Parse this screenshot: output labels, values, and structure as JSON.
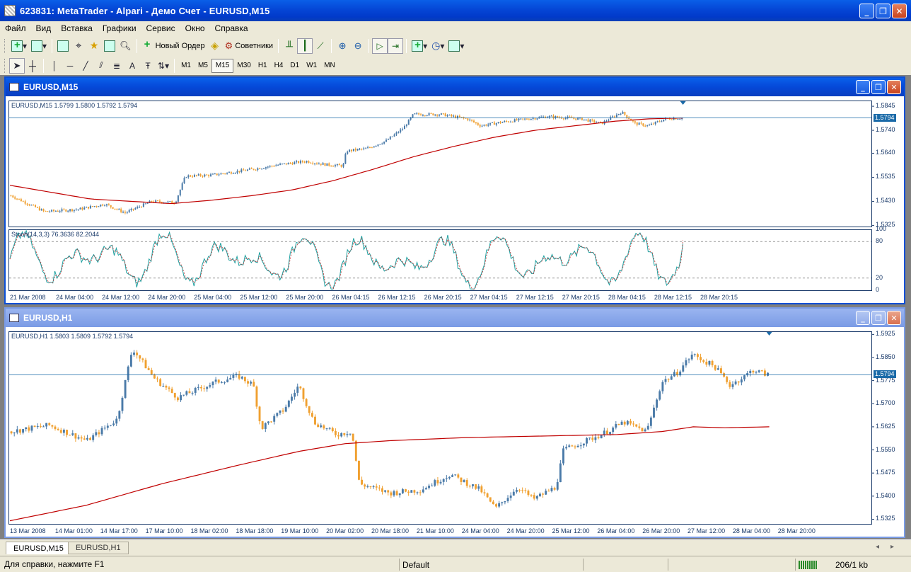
{
  "window": {
    "title": "623831: MetaTrader - Alpari - Демо Счет - EURUSD,M15"
  },
  "menu": [
    "Файл",
    "Вид",
    "Вставка",
    "Графики",
    "Сервис",
    "Окно",
    "Справка"
  ],
  "toolbar": {
    "new_order": "Новый Ордер",
    "experts": "Советники"
  },
  "timeframes": [
    "M1",
    "M5",
    "M15",
    "M30",
    "H1",
    "H4",
    "D1",
    "W1",
    "MN"
  ],
  "active_timeframe": "M15",
  "draw_tools": {
    "text_tool": "A"
  },
  "charts": [
    {
      "window_title": "EURUSD,M15",
      "info": "EURUSD,M15  1.5799 1.5800 1.5792 1.5794",
      "current_price": "1.5794",
      "yticks": [
        "1.5845",
        "1.5740",
        "1.5640",
        "1.5535",
        "1.5430",
        "1.5325"
      ],
      "ylim": [
        1.532,
        1.587
      ],
      "indicator_label": "Stoch(14,3,3) 76.3636 82.2044",
      "ind_ticks": [
        "100",
        "80",
        "20",
        "0"
      ],
      "xticks": [
        "21 Mar 2008",
        "24 Mar 04:00",
        "24 Mar 12:00",
        "24 Mar 20:00",
        "25 Mar 04:00",
        "25 Mar 12:00",
        "25 Mar 20:00",
        "26 Mar 04:15",
        "26 Mar 12:15",
        "26 Mar 20:15",
        "27 Mar 04:15",
        "27 Mar 12:15",
        "27 Mar 20:15",
        "28 Mar 04:15",
        "28 Mar 12:15",
        "28 Mar 20:15"
      ]
    },
    {
      "window_title": "EURUSD,H1",
      "info": "EURUSD,H1  1.5803 1.5809 1.5792 1.5794",
      "current_price": "1.5794",
      "yticks": [
        "1.5925",
        "1.5850",
        "1.5775",
        "1.5700",
        "1.5625",
        "1.5550",
        "1.5475",
        "1.5400",
        "1.5325"
      ],
      "ylim": [
        1.531,
        1.5935
      ],
      "xticks": [
        "13 Mar 2008",
        "14 Mar 01:00",
        "14 Mar 17:00",
        "17 Mar 10:00",
        "18 Mar 02:00",
        "18 Mar 18:00",
        "19 Mar 10:00",
        "20 Mar 02:00",
        "20 Mar 18:00",
        "21 Mar 10:00",
        "24 Mar 04:00",
        "24 Mar 20:00",
        "25 Mar 12:00",
        "26 Mar 04:00",
        "26 Mar 20:00",
        "27 Mar 12:00",
        "28 Mar 04:00",
        "28 Mar 20:00"
      ]
    }
  ],
  "tabs": [
    "EURUSD,M15",
    "EURUSD,H1"
  ],
  "status": {
    "help": "Для справки, нажмите F1",
    "profile": "Default",
    "traffic": "206/1 kb"
  },
  "colors": {
    "bull": "#4a7aa8",
    "bear": "#f0a030",
    "ma": "#c00000",
    "stoch_main": "#1fa0a0",
    "stoch_signal": "#c03030"
  },
  "chart_data": [
    {
      "type": "candlestick",
      "symbol": "EURUSD",
      "timeframe": "M15",
      "close_path": [
        [
          0,
          1.5455
        ],
        [
          0.05,
          1.5385
        ],
        [
          0.1,
          1.5395
        ],
        [
          0.14,
          1.5418
        ],
        [
          0.17,
          1.538
        ],
        [
          0.21,
          1.543
        ],
        [
          0.245,
          1.5425
        ],
        [
          0.26,
          1.554
        ],
        [
          0.3,
          1.5545
        ],
        [
          0.36,
          1.557
        ],
        [
          0.4,
          1.559
        ],
        [
          0.44,
          1.5605
        ],
        [
          0.47,
          1.559
        ],
        [
          0.495,
          1.5585
        ],
        [
          0.5,
          1.565
        ],
        [
          0.53,
          1.566
        ],
        [
          0.56,
          1.5695
        ],
        [
          0.585,
          1.575
        ],
        [
          0.6,
          1.581
        ],
        [
          0.64,
          1.581
        ],
        [
          0.68,
          1.579
        ],
        [
          0.7,
          1.576
        ],
        [
          0.73,
          1.5775
        ],
        [
          0.77,
          1.579
        ],
        [
          0.8,
          1.58
        ],
        [
          0.85,
          1.579
        ],
        [
          0.88,
          1.577
        ],
        [
          0.91,
          1.582
        ],
        [
          0.93,
          1.577
        ],
        [
          0.95,
          1.576
        ],
        [
          0.975,
          1.579
        ],
        [
          1,
          1.5794
        ]
      ],
      "ma_path": [
        [
          0,
          1.55
        ],
        [
          0.06,
          1.547
        ],
        [
          0.12,
          1.544
        ],
        [
          0.18,
          1.543
        ],
        [
          0.24,
          1.542
        ],
        [
          0.3,
          1.5435
        ],
        [
          0.36,
          1.5455
        ],
        [
          0.42,
          1.548
        ],
        [
          0.48,
          1.552
        ],
        [
          0.54,
          1.557
        ],
        [
          0.6,
          1.5625
        ],
        [
          0.66,
          1.567
        ],
        [
          0.72,
          1.571
        ],
        [
          0.78,
          1.574
        ],
        [
          0.84,
          1.576
        ],
        [
          0.9,
          1.578
        ],
        [
          0.95,
          1.579
        ],
        [
          1,
          1.5794
        ]
      ],
      "stochastic": {
        "k": 76.3636,
        "d": 82.2044,
        "levels": [
          20,
          80
        ]
      }
    },
    {
      "type": "candlestick",
      "symbol": "EURUSD",
      "timeframe": "H1",
      "close_path": [
        [
          0,
          1.561
        ],
        [
          0.05,
          1.563
        ],
        [
          0.1,
          1.558
        ],
        [
          0.14,
          1.565
        ],
        [
          0.16,
          1.588
        ],
        [
          0.19,
          1.578
        ],
        [
          0.22,
          1.572
        ],
        [
          0.27,
          1.577
        ],
        [
          0.3,
          1.579
        ],
        [
          0.32,
          1.576
        ],
        [
          0.33,
          1.562
        ],
        [
          0.36,
          1.568
        ],
        [
          0.38,
          1.576
        ],
        [
          0.4,
          1.564
        ],
        [
          0.43,
          1.56
        ],
        [
          0.45,
          1.561
        ],
        [
          0.46,
          1.544
        ],
        [
          0.5,
          1.541
        ],
        [
          0.54,
          1.542
        ],
        [
          0.58,
          1.547
        ],
        [
          0.62,
          1.542
        ],
        [
          0.64,
          1.536
        ],
        [
          0.67,
          1.543
        ],
        [
          0.69,
          1.539
        ],
        [
          0.72,
          1.543
        ],
        [
          0.73,
          1.555
        ],
        [
          0.78,
          1.56
        ],
        [
          0.81,
          1.564
        ],
        [
          0.84,
          1.561
        ],
        [
          0.86,
          1.577
        ],
        [
          0.88,
          1.58
        ],
        [
          0.9,
          1.586
        ],
        [
          0.93,
          1.582
        ],
        [
          0.95,
          1.576
        ],
        [
          0.97,
          1.579
        ],
        [
          0.98,
          1.581
        ],
        [
          1,
          1.5794
        ]
      ],
      "ma_path": [
        [
          0,
          1.532
        ],
        [
          0.1,
          1.537
        ],
        [
          0.2,
          1.544
        ],
        [
          0.3,
          1.55
        ],
        [
          0.38,
          1.5545
        ],
        [
          0.44,
          1.557
        ],
        [
          0.5,
          1.558
        ],
        [
          0.6,
          1.559
        ],
        [
          0.7,
          1.5595
        ],
        [
          0.8,
          1.56
        ],
        [
          0.86,
          1.561
        ],
        [
          0.9,
          1.5625
        ],
        [
          0.94,
          1.5622
        ],
        [
          1,
          1.5625
        ]
      ]
    }
  ]
}
